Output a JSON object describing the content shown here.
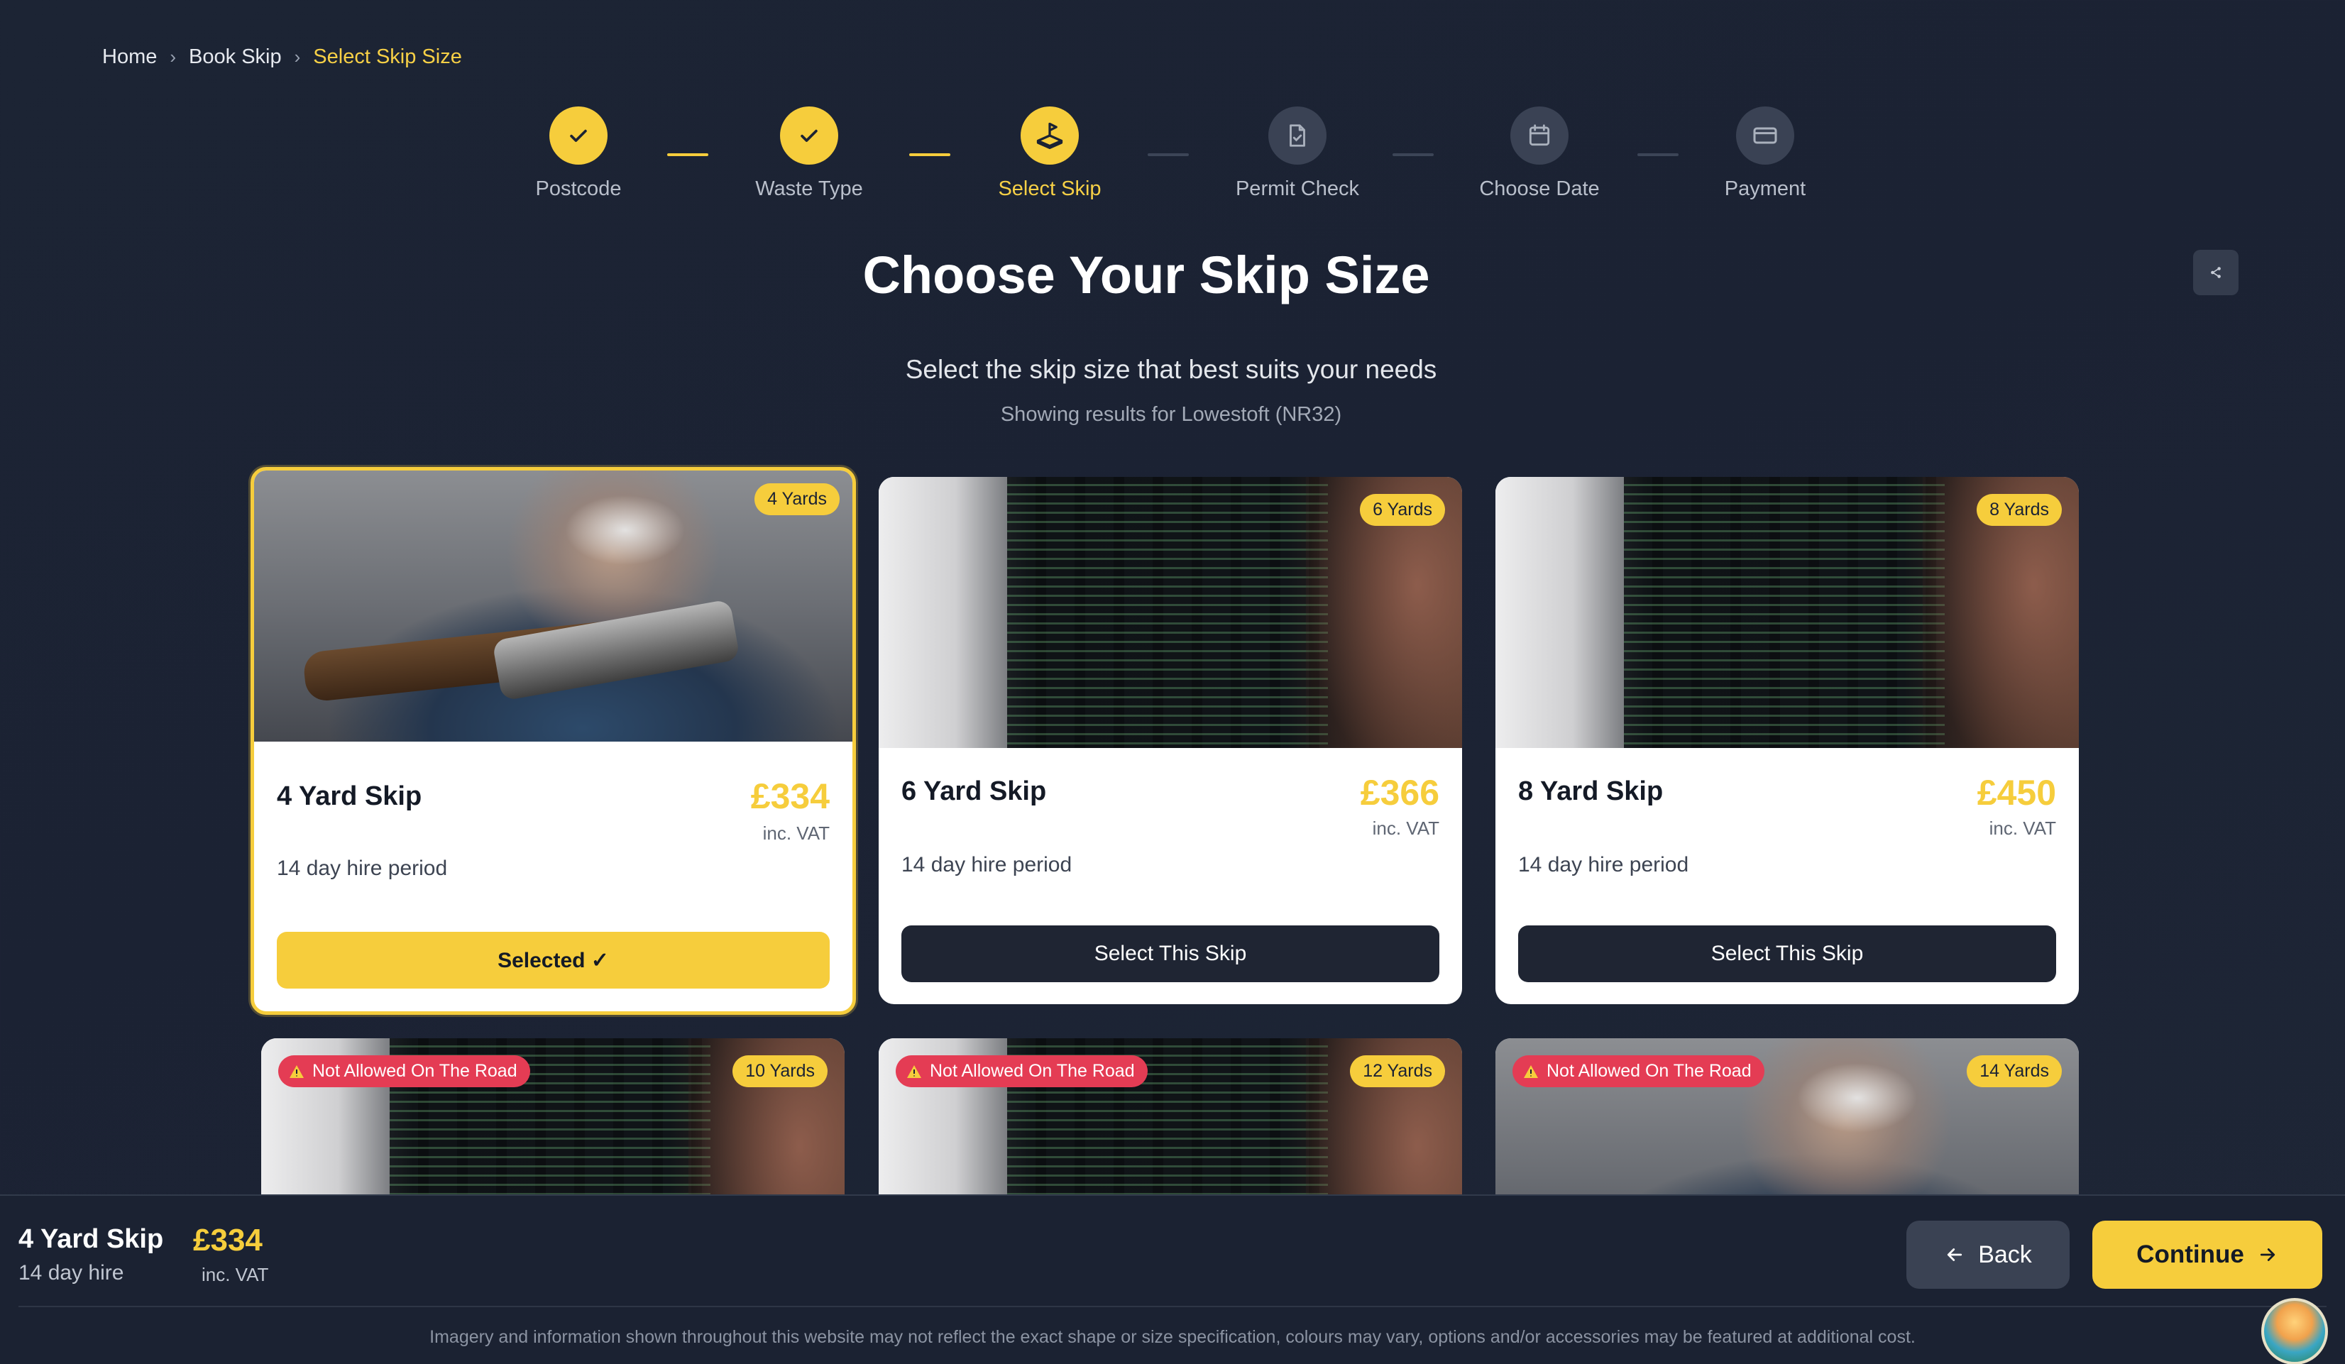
{
  "breadcrumb": {
    "home": "Home",
    "book": "Book Skip",
    "current": "Select Skip Size"
  },
  "steps": [
    {
      "label": "Postcode",
      "state": "done",
      "icon": "check-icon"
    },
    {
      "label": "Waste Type",
      "state": "done",
      "icon": "check-icon"
    },
    {
      "label": "Select Skip",
      "state": "active",
      "icon": "skip-icon"
    },
    {
      "label": "Permit Check",
      "state": "todo",
      "icon": "document-icon"
    },
    {
      "label": "Choose Date",
      "state": "todo",
      "icon": "calendar-icon"
    },
    {
      "label": "Payment",
      "state": "todo",
      "icon": "card-icon"
    }
  ],
  "heading": {
    "title": "Choose Your Skip Size",
    "subtitle": "Select the skip size that best suits your needs",
    "results": "Showing results for Lowestoft (NR32)"
  },
  "skips": [
    {
      "badge": "4 Yards",
      "name": "4 Yard Skip",
      "price": "£334",
      "vat": "inc. VAT",
      "hire": "14 day hire period",
      "button": "Selected ✓",
      "selected": true
    },
    {
      "badge": "6 Yards",
      "name": "6 Yard Skip",
      "price": "£366",
      "vat": "inc. VAT",
      "hire": "14 day hire period",
      "button": "Select This Skip",
      "selected": false
    },
    {
      "badge": "8 Yards",
      "name": "8 Yard Skip",
      "price": "£450",
      "vat": "inc. VAT",
      "hire": "14 day hire period",
      "button": "Select This Skip",
      "selected": false
    },
    {
      "badge": "10 Yards",
      "warning": "Not Allowed On The Road"
    },
    {
      "badge": "12 Yards",
      "warning": "Not Allowed On The Road"
    },
    {
      "badge": "14 Yards",
      "warning": "Not Allowed On The Road"
    }
  ],
  "summary": {
    "name": "4 Yard Skip",
    "hire": "14 day hire",
    "price": "£334",
    "vat": "inc. VAT",
    "back": "Back",
    "continue": "Continue",
    "disclaimer": "Imagery and information shown throughout this website may not reflect the exact shape or size specification, colours may vary, options and/or accessories may be featured at additional cost."
  },
  "colors": {
    "accent": "#f6cd3c",
    "background": "#1c2434",
    "warning": "#e43c54",
    "dark_button": "#1f2533"
  }
}
